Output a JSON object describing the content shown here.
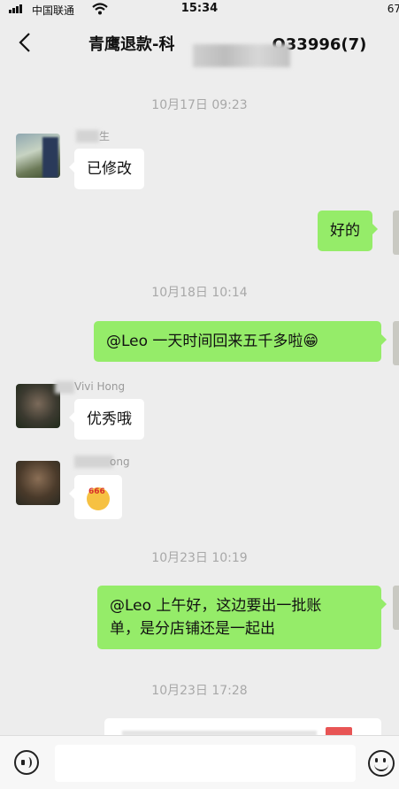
{
  "status_bar": {
    "carrier": "中国联通",
    "time": "15:34",
    "battery": "67"
  },
  "header": {
    "title": "青鹰退款-科",
    "title_suffix": "Q33996(7)"
  },
  "messages": [
    {
      "type": "timestamp",
      "text": "10月17日 09:23"
    },
    {
      "type": "received",
      "sender": "生",
      "text": "已修改"
    },
    {
      "type": "sent",
      "text": "好的"
    },
    {
      "type": "timestamp",
      "text": "10月18日 10:14"
    },
    {
      "type": "sent",
      "text": "@Leo 一天时间回来五千多啦😁"
    },
    {
      "type": "received",
      "sender": "Vivi Hong",
      "text": "优秀哦"
    },
    {
      "type": "received",
      "sender": "ong",
      "text": "666"
    },
    {
      "type": "timestamp",
      "text": "10月23日 10:19"
    },
    {
      "type": "sent",
      "text": "@Leo 上午好，这边要出一批账单，是分店铺还是一起出",
      "line1": "@Leo 上午好，这边要出一批账",
      "line2": "单，是分店铺还是一起出"
    },
    {
      "type": "timestamp",
      "text": "10月23日 17:28"
    }
  ],
  "colors": {
    "sent_bubble": "#95ec69",
    "received_bubble": "#ffffff",
    "background": "#ededed"
  },
  "icons": {
    "back": "chevron-left-icon",
    "voice": "voice-icon",
    "emoji": "emoji-icon",
    "wifi": "wifi-icon"
  }
}
